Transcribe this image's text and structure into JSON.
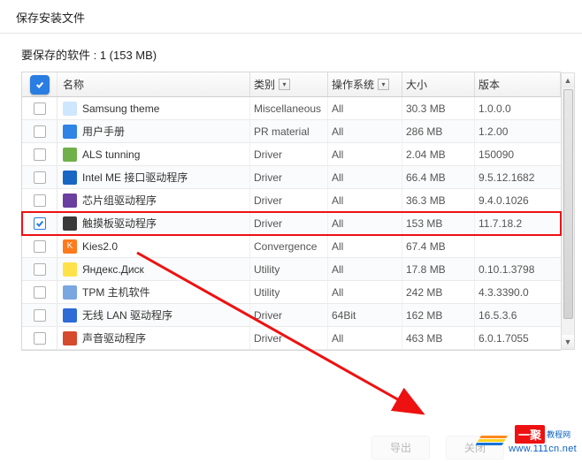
{
  "window_title": "保存安装文件",
  "subheader": "要保存的软件 : 1 (153 MB)",
  "columns": {
    "name": "名称",
    "category": "类别",
    "os": "操作系统",
    "size": "大小",
    "version": "版本"
  },
  "header_checked": true,
  "rows": [
    {
      "checked": false,
      "icon_bg": "#cfe6ff",
      "name": "Samsung theme",
      "category": "Miscellaneous",
      "os": "All",
      "size": "30.3 MB",
      "version": "1.0.0.0",
      "highlight": false
    },
    {
      "checked": false,
      "icon_bg": "#2f84e6",
      "name": "用户手册",
      "category": "PR material",
      "os": "All",
      "size": "286 MB",
      "version": "1.2.00",
      "highlight": false
    },
    {
      "checked": false,
      "icon_bg": "#6fb04a",
      "name": "ALS tunning",
      "category": "Driver",
      "os": "All",
      "size": "2.04 MB",
      "version": "150090",
      "highlight": false
    },
    {
      "checked": false,
      "icon_bg": "#1766c4",
      "name": "Intel ME 接口驱动程序",
      "category": "Driver",
      "os": "All",
      "size": "66.4 MB",
      "version": "9.5.12.1682",
      "highlight": false
    },
    {
      "checked": false,
      "icon_bg": "#6b3fa0",
      "name": "芯片组驱动程序",
      "category": "Driver",
      "os": "All",
      "size": "36.3 MB",
      "version": "9.4.0.1026",
      "highlight": false
    },
    {
      "checked": true,
      "icon_bg": "#3a3a3a",
      "name": "触摸板驱动程序",
      "category": "Driver",
      "os": "All",
      "size": "153 MB",
      "version": "11.7.18.2",
      "highlight": true
    },
    {
      "checked": false,
      "icon_bg": "#ff7a1c",
      "icon_text": "K",
      "name": "Kies2.0",
      "category": "Convergence",
      "os": "All",
      "size": "67.4 MB",
      "version": "",
      "highlight": false
    },
    {
      "checked": false,
      "icon_bg": "#ffe24a",
      "name": "Яндекс.Диск",
      "category": "Utility",
      "os": "All",
      "size": "17.8 MB",
      "version": "0.10.1.3798",
      "highlight": false
    },
    {
      "checked": false,
      "icon_bg": "#7aa7e0",
      "name": "TPM 主机软件",
      "category": "Utility",
      "os": "All",
      "size": "242 MB",
      "version": "4.3.3390.0",
      "highlight": false
    },
    {
      "checked": false,
      "icon_bg": "#2d6bd6",
      "name": "无线 LAN 驱动程序",
      "category": "Driver",
      "os": "64Bit",
      "size": "162 MB",
      "version": "16.5.3.6",
      "highlight": false
    },
    {
      "checked": false,
      "icon_bg": "#d64a2d",
      "name": "声音驱动程序",
      "category": "Driver",
      "os": "All",
      "size": "463 MB",
      "version": "6.0.1.7055",
      "highlight": false
    }
  ],
  "footer": {
    "export": "导出",
    "close": "关闭"
  },
  "watermark": {
    "brand": "一聚",
    "brand_suffix": "教程网",
    "url": "www.111cn.net"
  }
}
